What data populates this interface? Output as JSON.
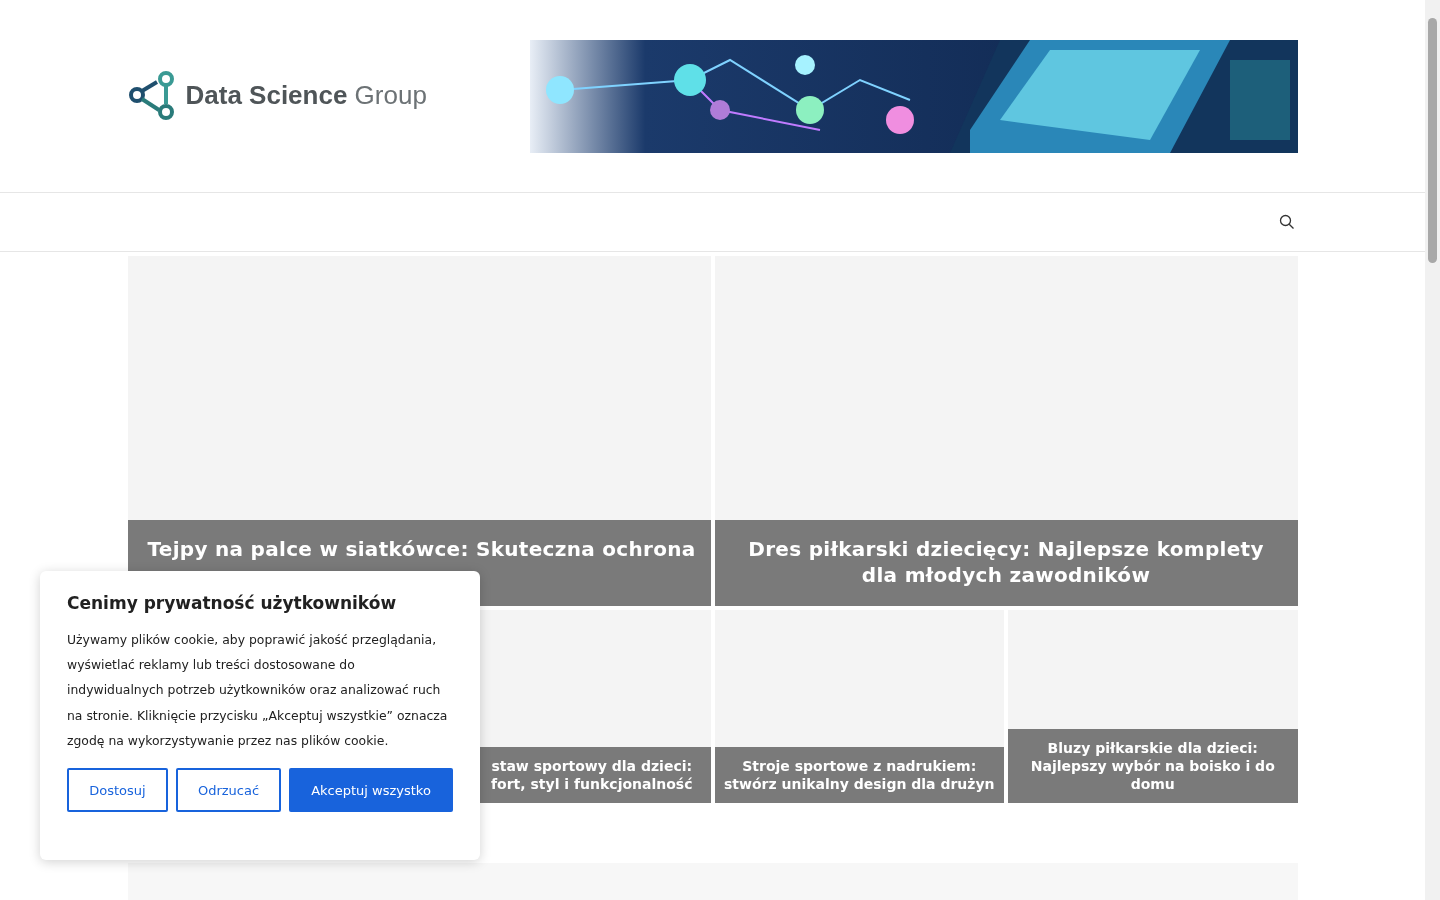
{
  "header": {
    "logo": {
      "word_bold": "Data Science",
      "word_light": "Group"
    }
  },
  "featured": [
    {
      "title_lines": [
        "Tejpy na palce w siatkówce: Skuteczna ochrona"
      ]
    },
    {
      "title_lines": [
        "Dres piłkarski dziecięcy: Najlepsze komplety",
        "dla młodych zawodników"
      ]
    }
  ],
  "small_cards": [
    {
      "title_lines": [
        "staw sportowy dla dzieci:",
        "fort, styl i funkcjonalność"
      ]
    },
    {
      "title_lines": [
        "Stroje sportowe z nadrukiem:",
        "stwórz unikalny design dla drużyn"
      ]
    },
    {
      "title_lines": [
        "Bluzy piłkarskie dla dzieci:",
        "Najlepszy wybór na boisko i do",
        "domu"
      ]
    }
  ],
  "cookie_banner": {
    "title": "Cenimy prywatność użytkowników",
    "text": "Używamy plików cookie, aby poprawić jakość przeglądania, wyświetlać reklamy lub treści dostosowane do indywidualnych potrzeb użytkowników oraz analizować ruch na stronie. Kliknięcie przycisku „Akceptuj wszystkie” oznacza zgodę na wykorzystywanie przez nas plików cookie.",
    "buttons": [
      {
        "label": "Dostosuj",
        "kind": "outline"
      },
      {
        "label": "Odrzucać",
        "kind": "outline"
      },
      {
        "label": "Akceptuj wszystko",
        "kind": "primary"
      }
    ]
  }
}
